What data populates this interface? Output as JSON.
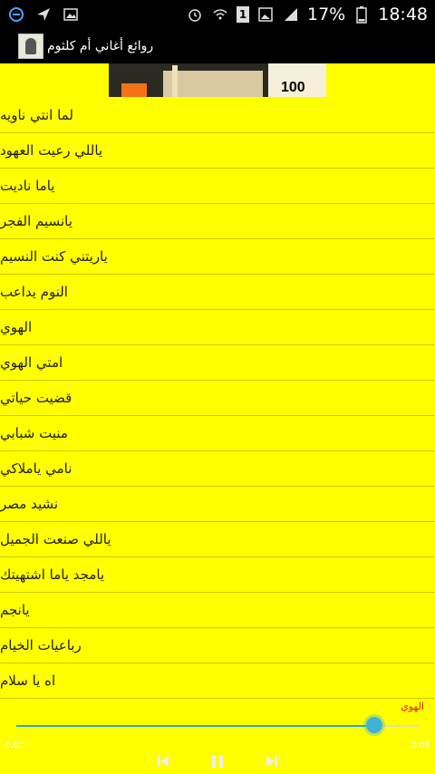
{
  "status_bar": {
    "battery_percent": "17%",
    "time": "18:48",
    "sim_badge": "1"
  },
  "app_bar": {
    "title": "روائع أغاني أم كلثوم"
  },
  "ad": {
    "text": "100"
  },
  "songs": [
    "لما انتي ناويه",
    "ياللي رعيت العهود",
    "ياما ناديت",
    "يانسيم الفجر",
    "ياريتني كنت النسيم",
    "النوم يداعب",
    "الهوي",
    "امتي الهوي",
    "قضيت حياتي",
    "منيت شبابي",
    "نامي ياملاكي",
    "نشيد مصر",
    "ياللي صنعت الجميل",
    "يامجد ياما اشتهيتك",
    "يانجم",
    "رباعيات الخيام",
    "اه يا سلام"
  ],
  "player": {
    "now_playing": "الهوي",
    "current_time": "0:07",
    "total_time": "0:08",
    "progress": 0.89
  },
  "colors": {
    "background": "#ffff00",
    "accent": "#3fb3d6",
    "now_playing": "#e0200f"
  }
}
